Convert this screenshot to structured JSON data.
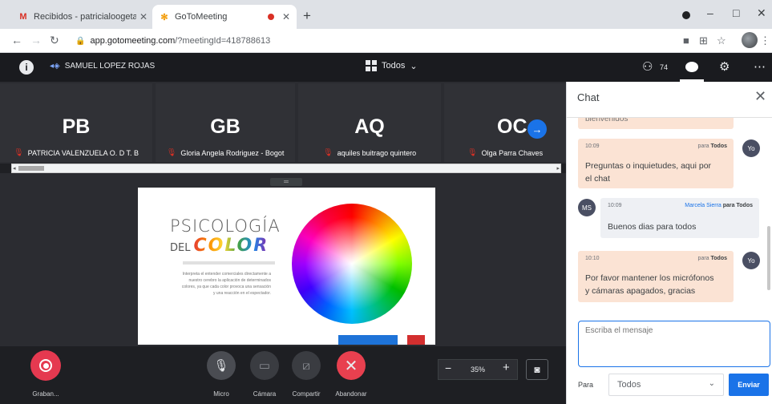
{
  "browser": {
    "tabs": [
      {
        "favicon": "M",
        "title": "Recibidos - patricialoogeta@g",
        "active": false
      },
      {
        "favicon": "✻",
        "title": "GoToMeeting",
        "active": true
      }
    ],
    "address": {
      "host": "app.gotomeeting.com",
      "path": "/?meetingId=418788613"
    }
  },
  "header": {
    "organizer": "SAMUEL LOPEZ ROJAS",
    "view_label": "Todos",
    "people_count": "74"
  },
  "participants": [
    {
      "initials": "PB",
      "name": "PATRICIA VALENZUELA O. D T. B"
    },
    {
      "initials": "GB",
      "name": "Gloria Angela Rodriguez - Bogot"
    },
    {
      "initials": "AQ",
      "name": "aquiles buitrago quintero"
    },
    {
      "initials": "OC",
      "name": "Olga Parra Chaves"
    }
  ],
  "slide": {
    "title_line1": "PSICOLOGÍA",
    "title_del": "DEL",
    "title_color": "COLOR",
    "body": "Interpreta el entender comerciales directamente a nuestro cerebro la aplicación de determinados colores, ya que cada color provoca una sensación y una reacción en el espectador."
  },
  "toolbar": {
    "record_label": "Graban...",
    "mic_label": "Micro",
    "camera_label": "Cámara",
    "share_label": "Compartir",
    "leave_label": "Abandonar",
    "zoom_value": "35%"
  },
  "chat": {
    "title": "Chat",
    "messages": [
      {
        "time": "",
        "to": "",
        "body": "bienvenidos",
        "direction": "out"
      },
      {
        "time": "10:09",
        "from": "Yo",
        "to_prefix": "para",
        "to": "Todos",
        "body_line1": "Preguntas o inquietudes, aqui por",
        "body_line2": "el chat",
        "avatar": "Yo",
        "direction": "out"
      },
      {
        "time": "10:09",
        "from": "Marcela Sierra",
        "to_prefix": "para",
        "to": "Todos",
        "body_line1": "Buenos dias para todos",
        "avatar": "MS",
        "direction": "in"
      },
      {
        "time": "10:10",
        "from": "Yo",
        "to_prefix": "para",
        "to": "Todos",
        "body_line1": "Por favor mantener los micrófonos",
        "body_line2": "y cámaras apagados, gracias",
        "avatar": "Yo",
        "direction": "out"
      }
    ],
    "compose_placeholder": "Escriba el mensaje",
    "to_label": "Para",
    "to_value": "Todos",
    "send_label": "Enviar"
  },
  "colors": {
    "accent": "#1a73e8",
    "record": "#e53950",
    "leave": "#e8404f",
    "own_msg": "#fbe3d4"
  }
}
